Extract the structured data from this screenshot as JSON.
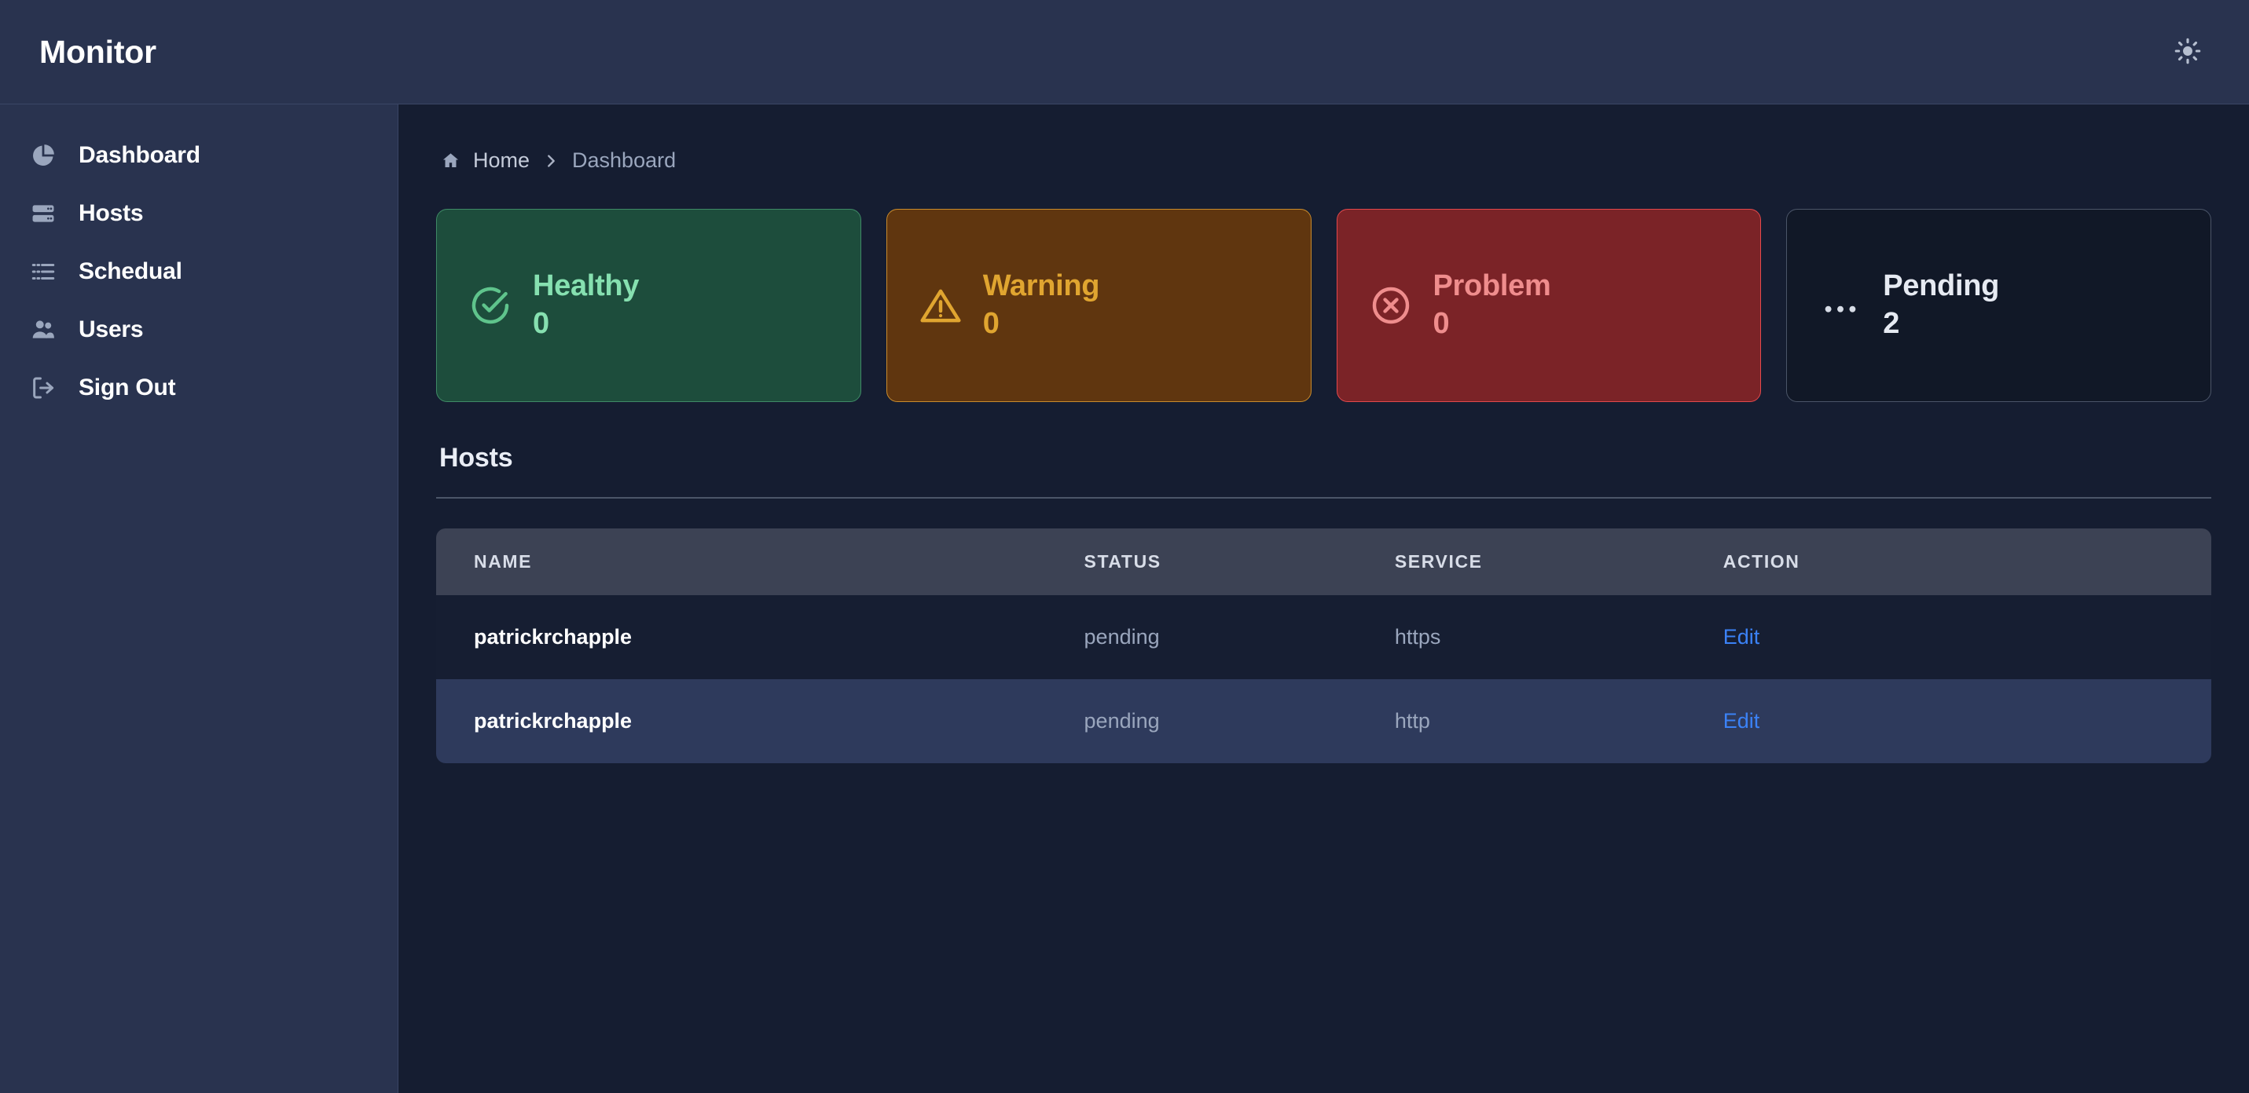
{
  "header": {
    "brand": "Monitor",
    "theme_toggle_icon": "sun-icon"
  },
  "sidebar": {
    "items": [
      {
        "label": "Dashboard",
        "icon": "pie-chart-icon"
      },
      {
        "label": "Hosts",
        "icon": "server-icon"
      },
      {
        "label": "Schedual",
        "icon": "list-icon"
      },
      {
        "label": "Users",
        "icon": "users-icon"
      },
      {
        "label": "Sign Out",
        "icon": "sign-out-icon"
      }
    ]
  },
  "breadcrumb": {
    "home_icon": "home-icon",
    "home_label": "Home",
    "separator_icon": "chevron-right-icon",
    "current": "Dashboard"
  },
  "status_cards": [
    {
      "id": "healthy",
      "title": "Healthy",
      "count": "0",
      "icon": "check-circle-icon",
      "bg": "#1d4d3c",
      "border": "#3f8a66",
      "fg": "#86e0b0"
    },
    {
      "id": "warning",
      "title": "Warning",
      "count": "0",
      "icon": "alert-triangle-icon",
      "bg": "#60360f",
      "border": "#c98b2c",
      "fg": "#e0a530"
    },
    {
      "id": "problem",
      "title": "Problem",
      "count": "0",
      "icon": "x-circle-icon",
      "bg": "#7b2327",
      "border": "#e2494c",
      "fg": "#ef8d8d"
    },
    {
      "id": "pending",
      "title": "Pending",
      "count": "2",
      "icon": "ellipsis-icon",
      "bg": "#111827",
      "border": "#4b5568",
      "fg": "#e6eaf2"
    }
  ],
  "hosts_section": {
    "title": "Hosts",
    "columns": [
      "NAME",
      "STATUS",
      "SERVICE",
      "ACTION"
    ],
    "rows": [
      {
        "name": "patrickrchapple",
        "status": "pending",
        "service": "https",
        "action": "Edit"
      },
      {
        "name": "patrickrchapple",
        "status": "pending",
        "service": "http",
        "action": "Edit"
      }
    ]
  },
  "colors": {
    "topbar_bg": "#29334f",
    "sidebar_bg": "#29334f",
    "main_bg": "#151d31",
    "table_header_bg": "#3c4254",
    "row_odd_bg": "#161e32",
    "row_even_bg": "#2e3a5c",
    "link_blue": "#3b82f6",
    "muted_text": "#9aa6bd"
  }
}
